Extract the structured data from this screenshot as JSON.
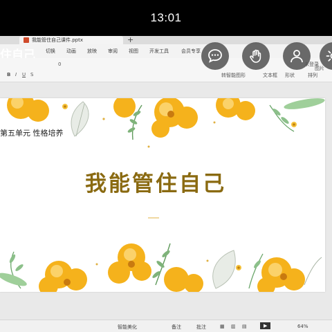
{
  "status_bar": {
    "time": "13:01"
  },
  "window": {
    "file_tab": "我能管住自己课件.pptx",
    "new_tab": "+"
  },
  "overlay_title": "住自己",
  "menu": {
    "items": [
      "切换",
      "动画",
      "放映",
      "审阅",
      "视图",
      "开发工具",
      "会员专享"
    ]
  },
  "toolbar": {
    "font_size": "0",
    "right_user": "未登录",
    "text_box": "文本框",
    "shape": "形状",
    "arrange": "排列",
    "smart_shape": "转智能图形",
    "image": "图片"
  },
  "slide": {
    "unit_text": "第五单元 性格培养",
    "title": "我能管住自己"
  },
  "bottom_bar": {
    "beautify": "智能美化",
    "notes": "备注",
    "comments": "批注",
    "zoom": "64%"
  },
  "colors": {
    "title": "#8a6a11",
    "flower": "#f5b21c",
    "leaf": "#6aa66a"
  },
  "icons": [
    "chat-icon",
    "wave-hand-icon",
    "person-icon",
    "gear-icon"
  ]
}
